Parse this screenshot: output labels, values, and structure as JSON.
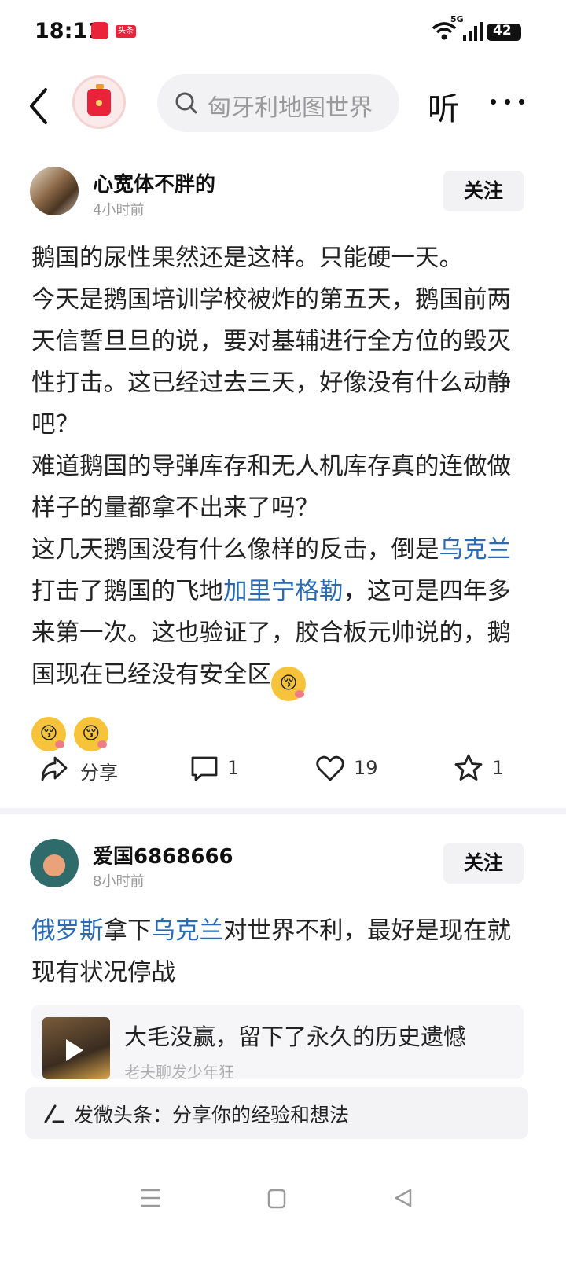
{
  "status_bar": {
    "time": "18:11",
    "app_badge": "头条",
    "network": "5G",
    "battery": "42"
  },
  "top_nav": {
    "search_placeholder": "匈牙利地图世界",
    "listen_label": "听"
  },
  "posts": [
    {
      "username": "心宽体不胖的",
      "time": "4小时前",
      "follow_label": "关注",
      "paragraphs": [
        "鹅国的尿性果然还是这样。只能硬一天。",
        "今天是鹅国培训学校被炸的第五天，鹅国前两天信誓旦旦的说，要对基辅进行全方位的毁灭性打击。这已经过去三天，好像没有什么动静吧？",
        "难道鹅国的导弹库存和无人机库存真的连做做样子的量都拿不出来了吗？"
      ],
      "para4": {
        "t1": "这几天鹅国没有什么像样的反击，倒是",
        "link1": "乌克兰",
        "t2": "打击了鹅国的飞地",
        "link2": "加里宁格勒",
        "t3": "，这可是四年多来第一次。这也验证了，胶合板元帅说的，鹅国现在已经没有安全区"
      },
      "emoji": "😚",
      "actions": {
        "share_label": "分享",
        "comments": "1",
        "likes": "19",
        "favorites": "1"
      }
    },
    {
      "username": "爱国6868666",
      "time": "8小时前",
      "follow_label": "关注",
      "content": {
        "link1": "俄罗斯",
        "t1": "拿下",
        "link2": "乌克兰",
        "t2": "对世界不利，最好是现在就现有状况停战"
      },
      "card": {
        "title": "大毛没赢，留下了永久的历史遗憾",
        "source": "老夫聊发少年狂"
      }
    }
  ],
  "compose": {
    "placeholder": "发微头条：分享你的经验和想法"
  },
  "colors": {
    "link": "#2a6bb5",
    "brand_red": "#e8233a"
  }
}
